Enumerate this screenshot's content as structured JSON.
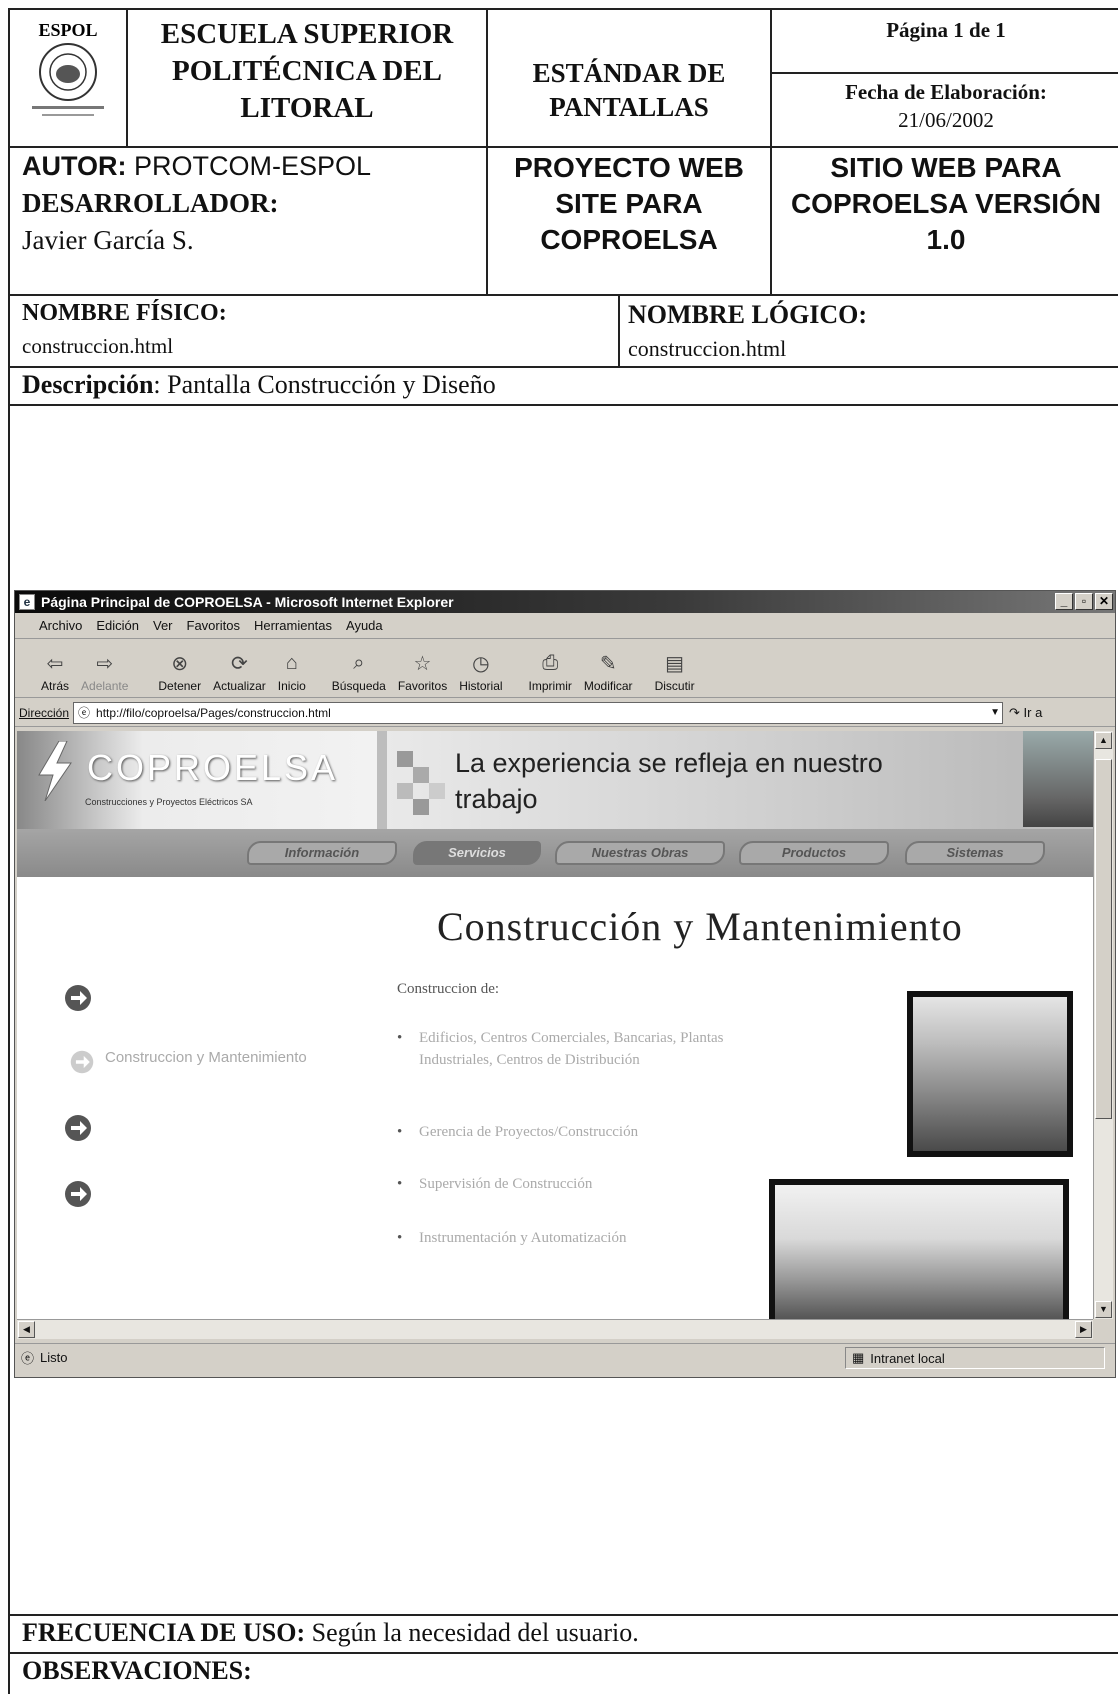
{
  "header": {
    "institution": "ESCUELA SUPERIOR POLITÉCNICA DEL LITORAL",
    "seal_text": "ESPOL",
    "standard": "ESTÁNDAR DE PANTALLAS",
    "page": "Página 1 de 1",
    "date_label": "Fecha de Elaboración:",
    "date_value": "21/06/2002"
  },
  "authors": {
    "author_label": "AUTOR:",
    "author_value": "PROTCOM-ESPOL",
    "dev_label": "DESARROLLADOR:",
    "dev_value": "Javier García S.",
    "project": "PROYECTO WEB SITE PARA COPROELSA",
    "site": "SITIO WEB PARA COPROELSA VERSIÓN 1.0"
  },
  "names": {
    "physical_label": "NOMBRE FÍSICO:",
    "physical_value": "construccion.html",
    "logical_label": "NOMBRE LÓGICO:",
    "logical_value": "construccion.html"
  },
  "description": {
    "label": "Descripción",
    "value": ": Pantalla Construcción y Diseño"
  },
  "browser": {
    "title": "Página Principal de COPROELSA - Microsoft Internet Explorer",
    "menu": [
      "Archivo",
      "Edición",
      "Ver",
      "Favoritos",
      "Herramientas",
      "Ayuda"
    ],
    "tools": [
      "Atrás",
      "Adelante",
      "Detener",
      "Actualizar",
      "Inicio",
      "Búsqueda",
      "Favoritos",
      "Historial",
      "Imprimir",
      "Modificar",
      "Discutir"
    ],
    "address_label": "Dirección",
    "address": "http://filo/coproelsa/Pages/construccion.html",
    "go": "Ir a",
    "status": "Listo",
    "zone": "Intranet local"
  },
  "site": {
    "logo": "COPROELSA",
    "logo_sub": "Construcciones y Proyectos Eléctricos SA",
    "tagline": "La experiencia se refleja en nuestro trabajo",
    "nav": [
      "Información",
      "Servicios",
      "Nuestras Obras",
      "Productos",
      "Sistemas"
    ],
    "heading": "Construcción y Mantenimiento",
    "side_label": "Construccion y Mantenimiento",
    "intro": "Construccion de:",
    "bullets": [
      "Edificios, Centros Comerciales, Bancarias, Plantas Industriales, Centros de Distribución",
      "Gerencia de Proyectos/Construcción",
      "Supervisión de Construcción",
      "Instrumentación y Automatización"
    ]
  },
  "footer": {
    "freq_label": "FRECUENCIA DE USO:",
    "freq_value": "Según la necesidad del usuario.",
    "obs_label": "OBSERVACIONES:"
  }
}
